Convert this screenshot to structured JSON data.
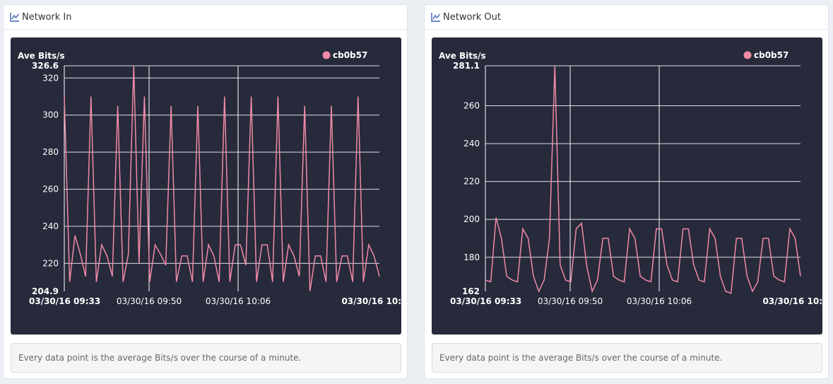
{
  "panels": [
    {
      "title": "Network In",
      "note": "Every data point is the average Bits/s over the course of a minute.",
      "icon": "line-chart-icon"
    },
    {
      "title": "Network Out",
      "note": "Every data point is the average Bits/s over the course of a minute.",
      "icon": "line-chart-icon"
    }
  ],
  "colors": {
    "series": "#f08aa6",
    "chart_bg": "#262a3b",
    "grid": "#ffffff",
    "icon": "#3f64b5"
  },
  "chart_data": [
    {
      "type": "line",
      "ylabel": "Ave Bits/s",
      "ylim": [
        204.9,
        326.6
      ],
      "yticks": [
        320,
        300,
        280,
        260,
        240,
        220
      ],
      "ymin_label": "204.9",
      "ymax_label": "326.6",
      "xticks": [
        "03/30/16 09:33",
        "03/30/16 09:50",
        "03/30/16 10:06",
        "03/30/16 10:"
      ],
      "xtick_bold": [
        true,
        false,
        false,
        true
      ],
      "legend_position": "top-right",
      "series": [
        {
          "name": "cb0b57",
          "values": [
            310,
            210,
            235,
            225,
            213,
            310,
            210,
            230,
            224,
            213,
            305,
            210,
            225,
            326.6,
            220,
            310,
            210,
            230,
            225,
            219,
            305,
            210,
            224,
            224,
            210,
            305,
            210,
            230,
            224,
            210,
            310,
            210,
            230,
            230,
            219,
            310,
            210,
            230,
            230,
            210,
            310,
            210,
            230,
            224,
            213,
            305,
            205,
            224,
            224,
            210,
            305,
            210,
            224,
            224,
            210,
            310,
            210,
            230,
            224,
            213
          ]
        }
      ]
    },
    {
      "type": "line",
      "ylabel": "Ave Bits/s",
      "ylim": [
        162,
        281.1
      ],
      "yticks": [
        260,
        240,
        220,
        200,
        180
      ],
      "ymin_label": "162",
      "ymax_label": "281.1",
      "xticks": [
        "03/30/16 09:33",
        "03/30/16 09:50",
        "03/30/16 10:06",
        "03/30/16 10:"
      ],
      "xtick_bold": [
        true,
        false,
        false,
        true
      ],
      "legend_position": "top-right",
      "series": [
        {
          "name": "cb0b57",
          "values": [
            168,
            167,
            201,
            190,
            170,
            168,
            167,
            195,
            190,
            170,
            162,
            168,
            190,
            281.1,
            176,
            168,
            167,
            195,
            198,
            175,
            162,
            168,
            190,
            190,
            170,
            168,
            167,
            195,
            190,
            170,
            168,
            167,
            195,
            195,
            176,
            168,
            167,
            195,
            195,
            176,
            168,
            167,
            195,
            190,
            170,
            162,
            161,
            190,
            190,
            170,
            162,
            167,
            190,
            190,
            170,
            168,
            167,
            195,
            190,
            170
          ]
        }
      ]
    }
  ]
}
